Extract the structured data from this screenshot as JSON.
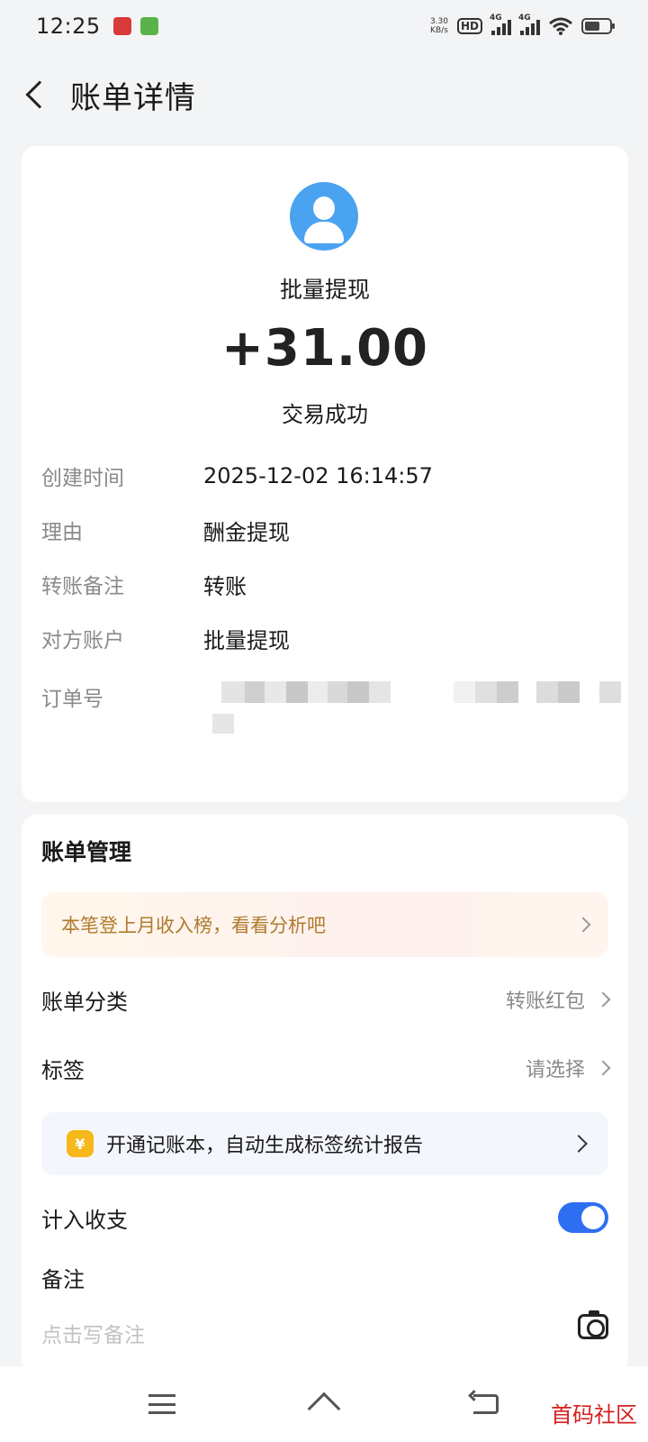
{
  "status_bar": {
    "time": "12:25",
    "net_speed_value": "3.30",
    "net_speed_unit": "KB/s",
    "hd_badge": "HD",
    "signal1_label": "4G",
    "signal2_label": "4G",
    "icons": [
      "app-icon-red",
      "app-icon-green",
      "wifi-icon",
      "battery-icon"
    ]
  },
  "header": {
    "back_icon": "chevron-left-icon",
    "title": "账单详情"
  },
  "transaction": {
    "avatar_icon": "user-icon",
    "party_name": "批量提现",
    "amount": "+31.00",
    "status": "交易成功",
    "fields": [
      {
        "label": "创建时间",
        "value": "2025-12-02 16:14:57"
      },
      {
        "label": "理由",
        "value": "酬金提现"
      },
      {
        "label": "转账备注",
        "value": "转账"
      },
      {
        "label": "对方账户",
        "value": "批量提现"
      },
      {
        "label": "订单号",
        "value": ""
      }
    ]
  },
  "management": {
    "title": "账单管理",
    "promo_text": "本笔登上月收入榜，看看分析吧",
    "category_label": "账单分类",
    "category_value": "转账红包",
    "tag_label": "标签",
    "tag_value": "请选择",
    "book_banner_text": "开通记账本，自动生成标签统计报告",
    "book_icon_glyph": "¥",
    "include_label": "计入收支",
    "include_enabled": true,
    "note_label": "备注",
    "note_placeholder": "点击写备注"
  },
  "watermark": "首码社区",
  "colors": {
    "accent": "#2e6ff2",
    "avatar": "#4aa3f0",
    "promo_text": "#b07a2c",
    "coin": "#f6b81a",
    "watermark": "#d42020"
  }
}
